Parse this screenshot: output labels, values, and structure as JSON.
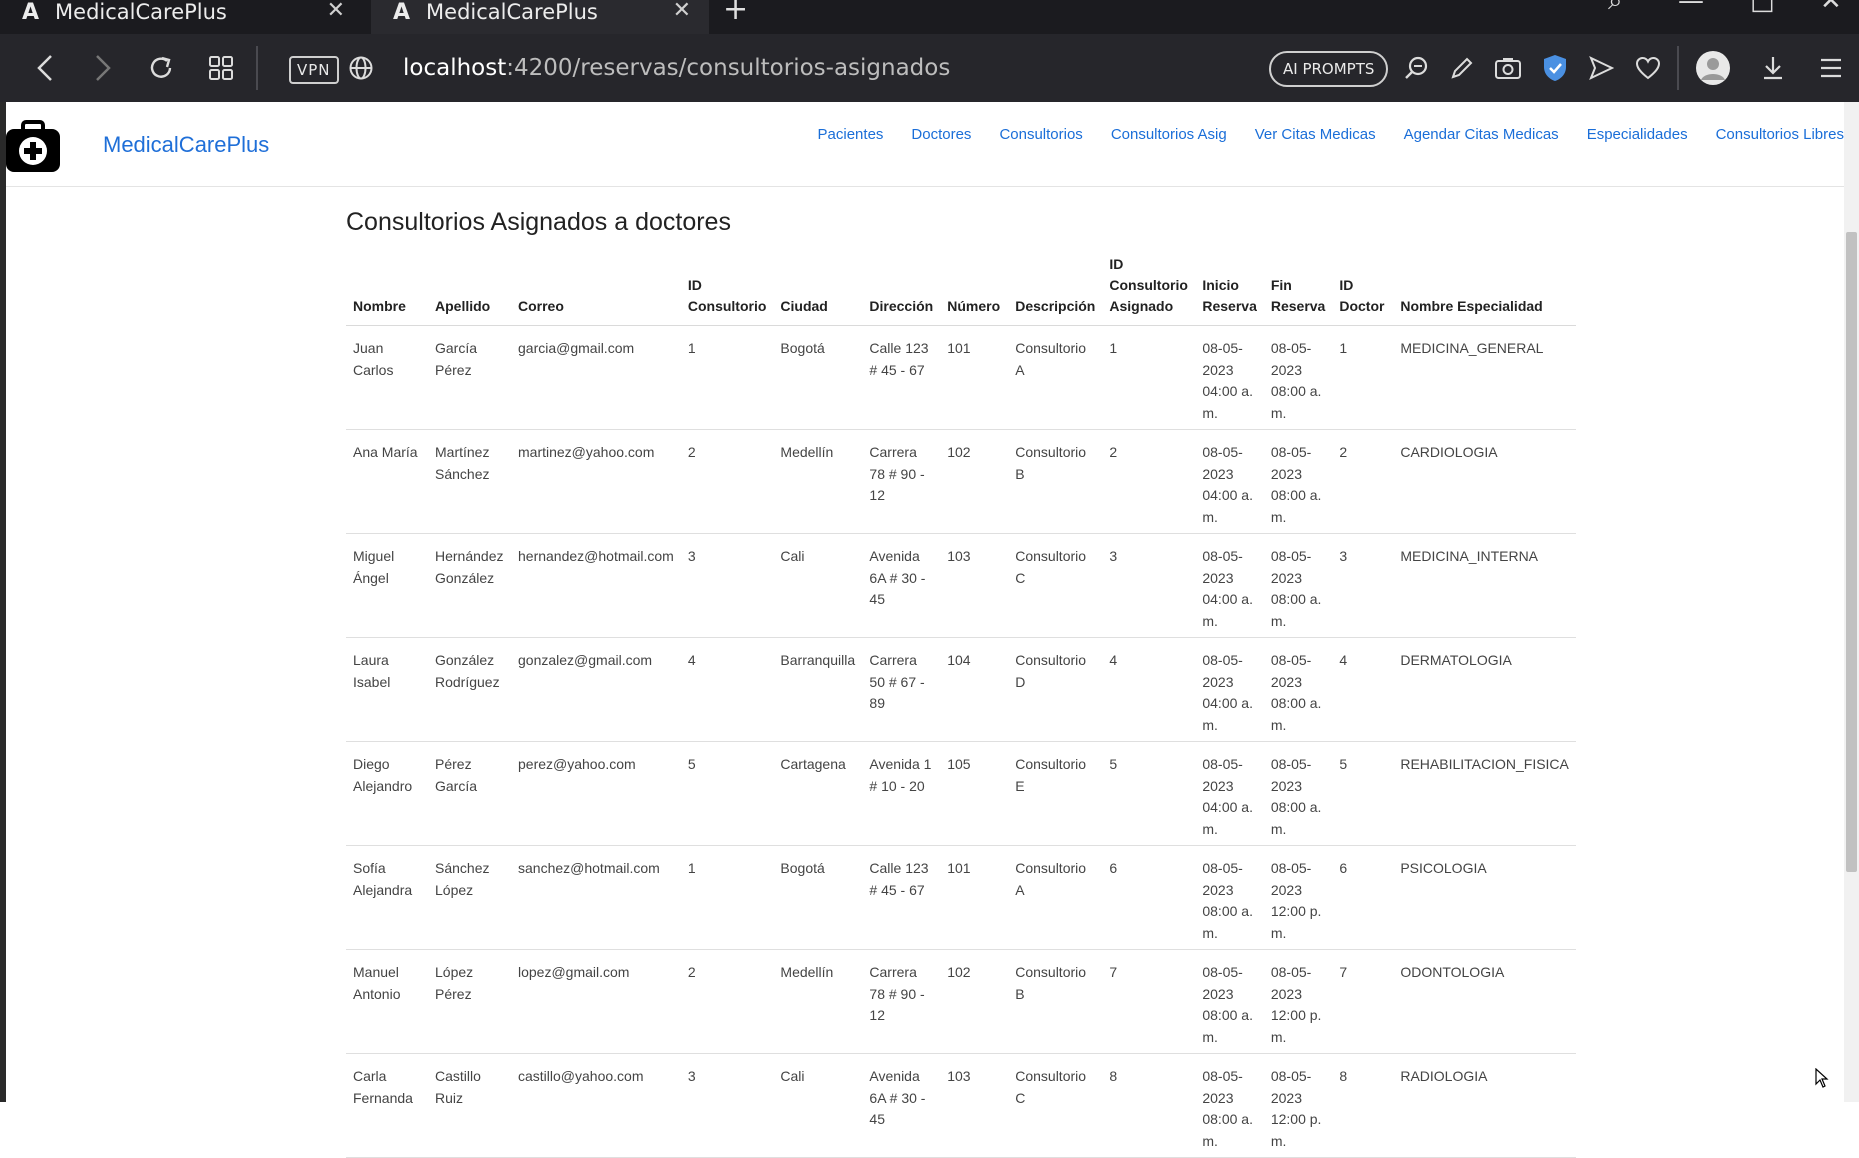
{
  "browser": {
    "tabs": [
      {
        "title": "MedicalCarePlus",
        "logo": "A"
      },
      {
        "title": "MedicalCarePlus",
        "logo": "A"
      }
    ],
    "url_host": "localhost",
    "url_path": ":4200/reservas/consultorios-asignados",
    "vpn_label": "VPN",
    "ai_prompts_label": "AI PROMPTS"
  },
  "app": {
    "brand": "MedicalCarePlus",
    "nav": [
      "Pacientes",
      "Doctores",
      "Consultorios",
      "Consultorios Asig",
      "Ver Citas Medicas",
      "Agendar Citas Medicas",
      "Especialidades",
      "Consultorios Libres"
    ]
  },
  "page": {
    "title": "Consultorios Asignados a doctores",
    "columns": [
      "Nombre",
      "Apellido",
      "Correo",
      "ID Consultorio",
      "Ciudad",
      "Dirección",
      "Número",
      "Descripción",
      "ID Consultorio Asignado",
      "Inicio Reserva",
      "Fin Reserva",
      "ID Doctor",
      "Nombre Especialidad"
    ],
    "rows": [
      [
        "Juan Carlos",
        "García Pérez",
        "garcia@gmail.com",
        "1",
        "Bogotá",
        "Calle 123 # 45 - 67",
        "101",
        "Consultorio A",
        "1",
        "08-05-2023 04:00 a. m.",
        "08-05-2023 08:00 a. m.",
        "1",
        "MEDICINA_GENERAL"
      ],
      [
        "Ana María",
        "Martínez Sánchez",
        "martinez@yahoo.com",
        "2",
        "Medellín",
        "Carrera 78 # 90 - 12",
        "102",
        "Consultorio B",
        "2",
        "08-05-2023 04:00 a. m.",
        "08-05-2023 08:00 a. m.",
        "2",
        "CARDIOLOGIA"
      ],
      [
        "Miguel Ángel",
        "Hernández González",
        "hernandez@hotmail.com",
        "3",
        "Cali",
        "Avenida 6A # 30 - 45",
        "103",
        "Consultorio C",
        "3",
        "08-05-2023 04:00 a. m.",
        "08-05-2023 08:00 a. m.",
        "3",
        "MEDICINA_INTERNA"
      ],
      [
        "Laura Isabel",
        "González Rodríguez",
        "gonzalez@gmail.com",
        "4",
        "Barranquilla",
        "Carrera 50 # 67 - 89",
        "104",
        "Consultorio D",
        "4",
        "08-05-2023 04:00 a. m.",
        "08-05-2023 08:00 a. m.",
        "4",
        "DERMATOLOGIA"
      ],
      [
        "Diego Alejandro",
        "Pérez García",
        "perez@yahoo.com",
        "5",
        "Cartagena",
        "Avenida 1 # 10 - 20",
        "105",
        "Consultorio E",
        "5",
        "08-05-2023 04:00 a. m.",
        "08-05-2023 08:00 a. m.",
        "5",
        "REHABILITACION_FISICA"
      ],
      [
        "Sofía Alejandra",
        "Sánchez López",
        "sanchez@hotmail.com",
        "1",
        "Bogotá",
        "Calle 123 # 45 - 67",
        "101",
        "Consultorio A",
        "6",
        "08-05-2023 08:00 a. m.",
        "08-05-2023 12:00 p. m.",
        "6",
        "PSICOLOGIA"
      ],
      [
        "Manuel Antonio",
        "López Pérez",
        "lopez@gmail.com",
        "2",
        "Medellín",
        "Carrera 78 # 90 - 12",
        "102",
        "Consultorio B",
        "7",
        "08-05-2023 08:00 a. m.",
        "08-05-2023 12:00 p. m.",
        "7",
        "ODONTOLOGIA"
      ],
      [
        "Carla Fernanda",
        "Castillo Ruiz",
        "castillo@yahoo.com",
        "3",
        "Cali",
        "Avenida 6A # 30 - 45",
        "103",
        "Consultorio C",
        "8",
        "08-05-2023 08:00 a. m.",
        "08-05-2023 12:00 p. m.",
        "8",
        "RADIOLOGIA"
      ]
    ]
  }
}
